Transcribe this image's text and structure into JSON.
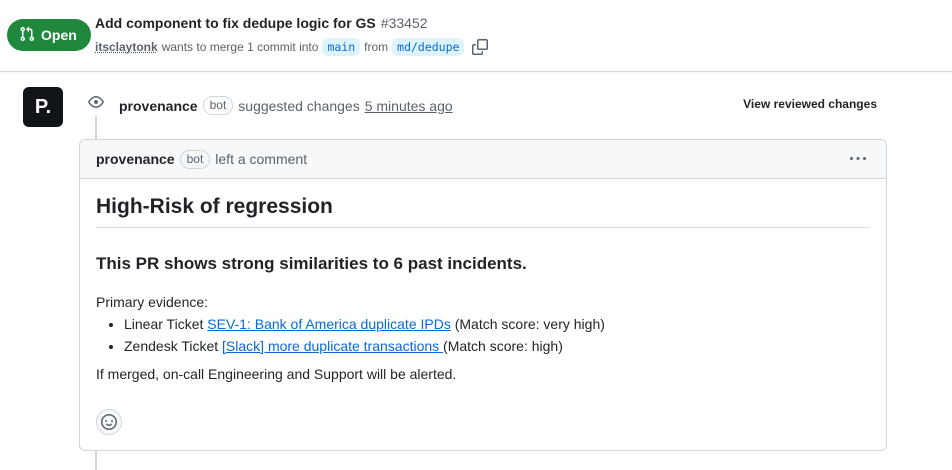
{
  "pr": {
    "state": "Open",
    "title": "Add component to fix dedupe logic for GS",
    "number": "#33452",
    "author": "itsclaytonk",
    "merge_text": "wants to merge 1 commit into",
    "base_branch": "main",
    "from_text": "from",
    "head_branch": "md/dedupe"
  },
  "review": {
    "avatar_text": "P.",
    "reviewer": "provenance",
    "bot_label": "bot",
    "action": "suggested changes",
    "time": "5 minutes ago",
    "view_changes": "View reviewed changes"
  },
  "comment": {
    "author": "provenance",
    "bot_label": "bot",
    "action": "left a comment",
    "heading": "High-Risk of regression",
    "subheading": "This PR shows strong similarities to 6 past incidents.",
    "evidence_label": "Primary evidence:",
    "items": [
      {
        "prefix": "Linear Ticket",
        "link": " SEV-1: Bank of America duplicate IPDs",
        "suffix": "(Match score: very high)"
      },
      {
        "prefix": "Zendesk Ticket",
        "link": "[Slack] more duplicate transactions ",
        "suffix": "(Match score: high)"
      }
    ],
    "footer": "If merged, on-call Engineering and Support will be alerted."
  },
  "colors": {
    "open_green": "#1f883d",
    "link_blue": "#0969da",
    "avatar_bg": "#101418"
  },
  "icons": [
    "git-pull-request-icon",
    "copy-icon",
    "eye-icon",
    "kebab-menu-icon",
    "smiley-icon"
  ]
}
